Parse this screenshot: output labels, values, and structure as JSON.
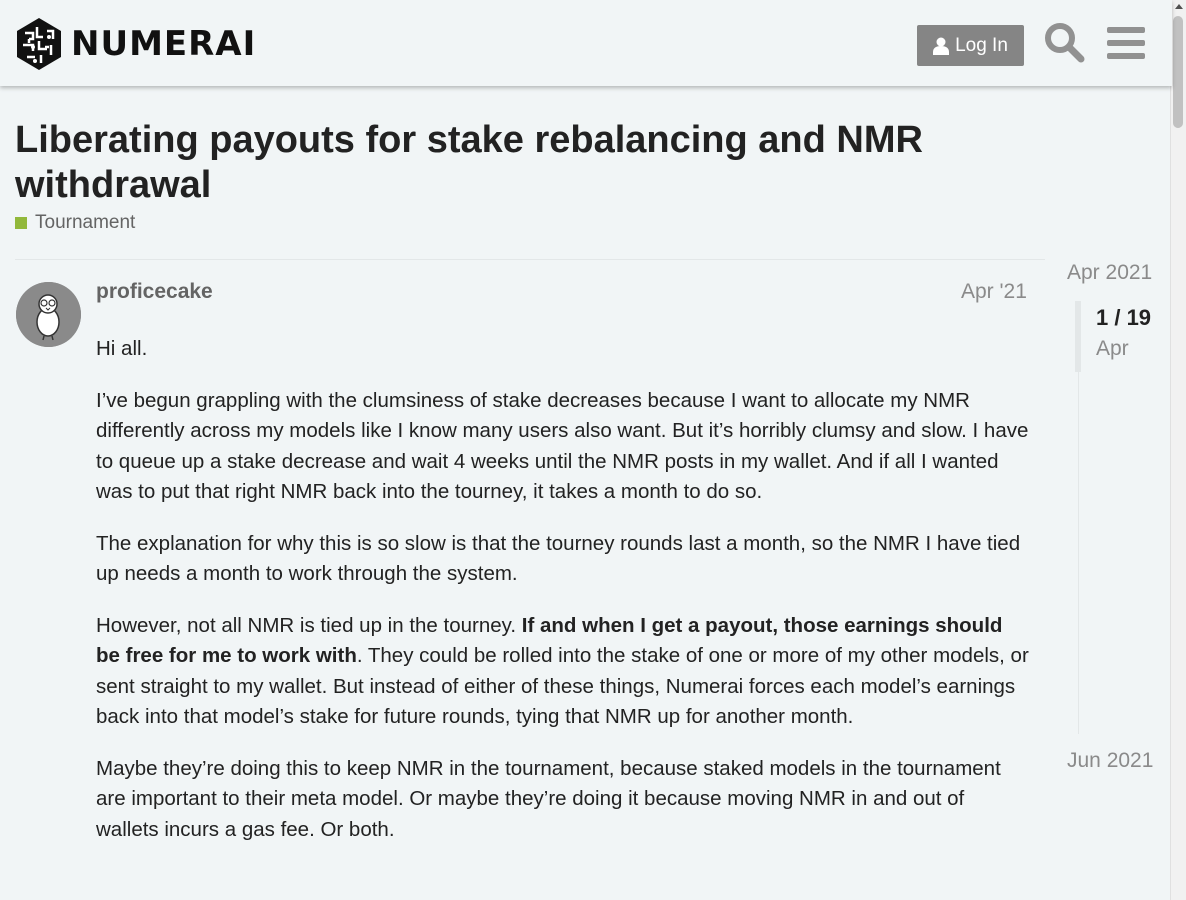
{
  "header": {
    "brand": "NUMERAI",
    "login_label": "Log In",
    "search_icon": "search-icon",
    "menu_icon": "hamburger-menu-icon"
  },
  "topic": {
    "title": "Liberating payouts for stake rebalancing and NMR withdrawal",
    "category": "Tournament",
    "category_color": "#92b83b"
  },
  "post": {
    "username": "proficecake",
    "date": "Apr '21",
    "p1": "Hi all.",
    "p2": "I’ve begun grappling with the clumsiness of stake decreases because I want to allocate my NMR differently across my models like I know many users also want. But it’s horribly clumsy and slow. I have to queue up a stake decrease and wait 4 weeks until the NMR posts in my wallet. And if all I wanted was to put that right NMR back into the tourney, it takes a month to do so.",
    "p3": "The explanation for why this is so slow is that the tourney rounds last a month, so the NMR I have tied up needs a month to work through the system.",
    "p4_a": "However, not all NMR is tied up in the tourney. ",
    "p4_bold": "If and when I get a payout, those earnings should be free for me to work with",
    "p4_b": ". They could be rolled into the stake of one or more of my other models, or sent straight to my wallet. But instead of either of these things, Numerai forces each model’s earnings back into that model’s stake for future rounds, tying that NMR up for another month.",
    "p5": "Maybe they’re doing this to keep NMR in the tournament, because staked models in the tournament are important to their meta model. Or maybe they’re doing it because moving NMR in and out of wallets incurs a gas fee. Or both."
  },
  "timeline": {
    "start": "Apr 2021",
    "count": "1 / 19",
    "current_date": "Apr",
    "end": "Jun 2021"
  }
}
